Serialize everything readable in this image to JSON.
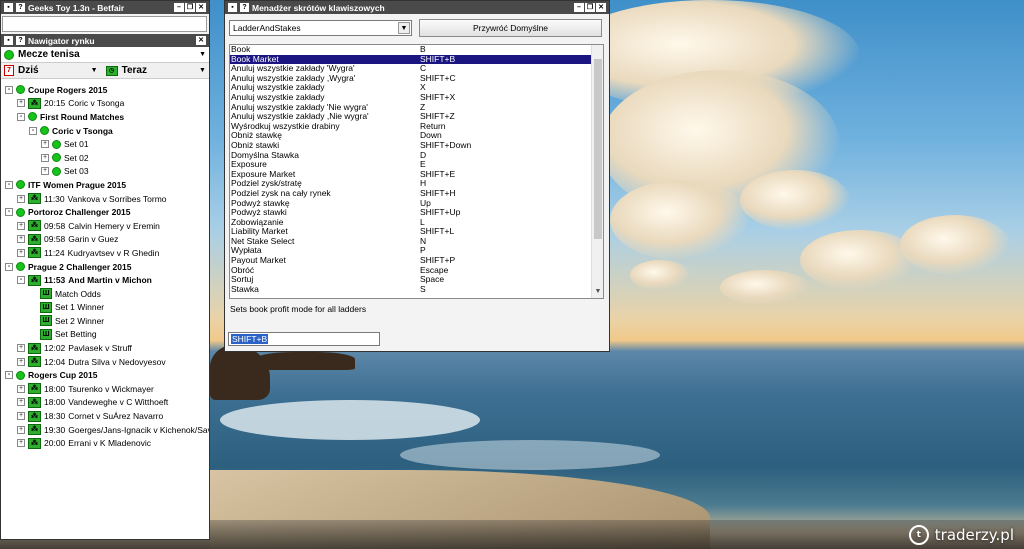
{
  "app": {
    "title": "Geeks Toy 1.3n - Betfair",
    "search_value": ""
  },
  "navigator": {
    "title": "Nawigator rynku",
    "sport": "Mecze tenisa",
    "date_label": "Dziś",
    "time_label": "Teraz",
    "tree": [
      {
        "type": "competition",
        "label": "Coupe Rogers 2015",
        "depth": 0,
        "expander": "-"
      },
      {
        "type": "event",
        "time": "20:15",
        "label": "Coric v Tsonga",
        "depth": 1,
        "expander": "+"
      },
      {
        "type": "competition",
        "label": "First Round Matches",
        "depth": 1,
        "expander": "-"
      },
      {
        "type": "competition",
        "label": "Coric v Tsonga",
        "depth": 2,
        "expander": "-"
      },
      {
        "type": "set",
        "label": "Set 01",
        "depth": 3,
        "expander": "+"
      },
      {
        "type": "set",
        "label": "Set 02",
        "depth": 3,
        "expander": "+"
      },
      {
        "type": "set",
        "label": "Set 03",
        "depth": 3,
        "expander": "+"
      },
      {
        "type": "competition",
        "label": "ITF Women Prague 2015",
        "depth": 0,
        "expander": "-"
      },
      {
        "type": "event",
        "time": "11:30",
        "label": "Vankova v Sorribes Tormo",
        "depth": 1,
        "expander": "+"
      },
      {
        "type": "competition",
        "label": "Portoroz Challenger 2015",
        "depth": 0,
        "expander": "-"
      },
      {
        "type": "event",
        "time": "09:58",
        "label": "Calvin Hemery v Eremin",
        "depth": 1,
        "expander": "+"
      },
      {
        "type": "event",
        "time": "09:58",
        "label": "Garin v Guez",
        "depth": 1,
        "expander": "+"
      },
      {
        "type": "event",
        "time": "11:24",
        "label": "Kudryavtsev v R Ghedin",
        "depth": 1,
        "expander": "+"
      },
      {
        "type": "competition",
        "label": "Prague 2 Challenger 2015",
        "depth": 0,
        "expander": "-"
      },
      {
        "type": "event-bold",
        "time": "11:53",
        "label": "And Martin v Michon",
        "depth": 1,
        "expander": "-"
      },
      {
        "type": "market",
        "label": "Match Odds",
        "depth": 2
      },
      {
        "type": "market",
        "label": "Set 1 Winner",
        "depth": 2
      },
      {
        "type": "market",
        "label": "Set 2 Winner",
        "depth": 2
      },
      {
        "type": "market",
        "label": "Set Betting",
        "depth": 2
      },
      {
        "type": "event",
        "time": "12:02",
        "label": "Pavlasek v Struff",
        "depth": 1,
        "expander": "+"
      },
      {
        "type": "event",
        "time": "12:04",
        "label": "Dutra Silva v Nedovyesov",
        "depth": 1,
        "expander": "+"
      },
      {
        "type": "competition",
        "label": "Rogers Cup 2015",
        "depth": 0,
        "expander": "-"
      },
      {
        "type": "event",
        "time": "18:00",
        "label": "Tsurenko v Wickmayer",
        "depth": 1,
        "expander": "+"
      },
      {
        "type": "event",
        "time": "18:00",
        "label": "Vandeweghe v C Witthoeft",
        "depth": 1,
        "expander": "+"
      },
      {
        "type": "event",
        "time": "18:30",
        "label": "Cornet v SuÁrez Navarro",
        "depth": 1,
        "expander": "+"
      },
      {
        "type": "event",
        "time": "19:30",
        "label": "Goerges/Jans-Ignacik v Kichenok/Savc",
        "depth": 1,
        "expander": "+"
      },
      {
        "type": "event",
        "time": "20:00",
        "label": "Errani v K Mladenovic",
        "depth": 1,
        "expander": "+"
      }
    ]
  },
  "dialog": {
    "title": "Menadżer skrótów klawiszowych",
    "profile": "LadderAndStakes",
    "restore_button": "Przywróć Domyślne",
    "selected_index": 1,
    "shortcuts": [
      [
        "Book",
        "B"
      ],
      [
        "Book Market",
        "SHIFT+B"
      ],
      [
        "Anuluj wszystkie zakłady 'Wygra'",
        "C"
      ],
      [
        "Anuluj wszystkie zakłady ,Wygra'",
        "SHIFT+C"
      ],
      [
        "Anuluj wszystkie zakłady",
        "X"
      ],
      [
        "Anuluj wszystkie zakłady",
        "SHIFT+X"
      ],
      [
        "Anuluj wszystkie zakłady 'Nie wygra'",
        "Z"
      ],
      [
        "Anuluj wszystkie zakłady ,Nie wygra'",
        "SHIFT+Z"
      ],
      [
        "Wyśrodkuj wszystkie drabiny",
        "Return"
      ],
      [
        "Obniż stawkę",
        "Down"
      ],
      [
        "Obniż stawki",
        "SHIFT+Down"
      ],
      [
        "Domyślna Stawka",
        "D"
      ],
      [
        "Exposure",
        "E"
      ],
      [
        "Exposure Market",
        "SHIFT+E"
      ],
      [
        "Podziel zysk/stratę",
        "H"
      ],
      [
        "Podziel zysk na cały rynek",
        "SHIFT+H"
      ],
      [
        "Podwyż stawkę",
        "Up"
      ],
      [
        "Podwyż stawki",
        "SHIFT+Up"
      ],
      [
        "Zobowiązanie",
        "L"
      ],
      [
        "Liability Market",
        "SHIFT+L"
      ],
      [
        "Net Stake Select",
        "N"
      ],
      [
        "Wypłata",
        "P"
      ],
      [
        "Payout Market",
        "SHIFT+P"
      ],
      [
        "Obróć",
        "Escape"
      ],
      [
        "Sortuj",
        "Space"
      ],
      [
        "Stawka",
        "S"
      ]
    ],
    "description": "Sets book profit mode for all ladders",
    "shortcut_value": "SHIFT+B"
  },
  "watermark": "traderzy.pl"
}
